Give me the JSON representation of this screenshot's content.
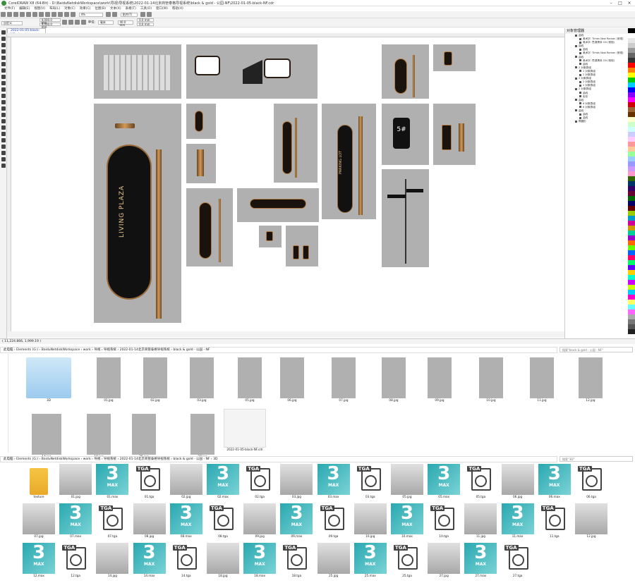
{
  "window": {
    "title": "CorelDRAW X8 (64-Bit) - D:\\BaiduNetdiskWorkspace\\work\\导视\\导视系统\\2022-01-14北京商管泰格导视系统\\black & gold - 公园-NF\\2022-01-05-black-NF.cdr"
  },
  "menubar": {
    "items": [
      "文件(F)",
      "编辑(E)",
      "视图(V)",
      "布局(L)",
      "对象(C)",
      "效果(C)",
      "位图(B)",
      "文本(X)",
      "表格(T)",
      "工具(O)",
      "窗口(W)",
      "帮助(H)"
    ]
  },
  "toolbar": {
    "preset": "自定义",
    "width": "4,000.0 mm",
    "height": "4,000.0 mm",
    "unit_label": "单位:",
    "unit": "毫米",
    "nudge": "40.0 mm",
    "dup_x": "0.0 mm",
    "dup_y": "0.0 mm",
    "zoom": "4%",
    "snap": "贴齐(T)"
  },
  "document": {
    "tab": "2022-01-05-black-NF.cdr"
  },
  "canvas": {
    "sign_text": "LIVING PLAZA",
    "parking_text": "PARKING LOT",
    "number_text": "5#"
  },
  "objects_panel": {
    "title": "对象管理器",
    "rows": [
      "曲线",
      "美术字: Times New Roman (常规)",
      "美术字: 思源黑体 CN (常规)",
      "曲线",
      "曲线",
      "美术字: Times New Roman (常规)",
      "曲线",
      "美术字: 思源黑体 CN (常规)",
      "曲线",
      "2 对象群组",
      "2 对象群组",
      "2 对象群组",
      "2 对象群组",
      "2 对象群组",
      "2 对象群组",
      "2 对象群组",
      "曲线",
      "矩形",
      "曲线",
      "6 对象群组",
      "6 对象群组",
      "曲线",
      "曲线",
      "曲线",
      "椭圆形"
    ]
  },
  "statusbar": {
    "text": "( 11,224.866, 1,999.19 )"
  },
  "explorer1": {
    "path": [
      "此电脑",
      "Elements (G:)",
      "BaiduNetdiskWorkspace",
      "work",
      "导视",
      "导视系统",
      "2022-01-14北京商管泰格导视系统",
      "black & gold - 公园 - NF"
    ],
    "search": "搜索\"black & gold - 公园 - NF\"",
    "files": [
      "3D",
      "01.jpg",
      "02.jpg",
      "03.jpg",
      "05.jpg",
      "06.jpg",
      "07.jpg",
      "08.jpg",
      "09.jpg",
      "10.jpg",
      "11.jpg",
      "12.jpg",
      "14.jpg",
      "18.jpg",
      "25.jpg",
      "27.jpg",
      "2022-01-05-black-NF.cdr"
    ]
  },
  "explorer2": {
    "path": [
      "此电脑",
      "Elements (G:)",
      "BaiduNetdiskWorkspace",
      "work",
      "导视",
      "导视系统",
      "2022-01-14北京商管泰格导视系统",
      "black & gold - 公园 - NF",
      "3D"
    ],
    "search": "搜索\"3D\"",
    "files": [
      {
        "name": "texture",
        "kind": "folder"
      },
      {
        "name": "01.jpg",
        "kind": "jpg"
      },
      {
        "name": "01.max",
        "kind": "max"
      },
      {
        "name": "01.tga",
        "kind": "tga"
      },
      {
        "name": "02.jpg",
        "kind": "jpg"
      },
      {
        "name": "02.max",
        "kind": "max"
      },
      {
        "name": "02.tga",
        "kind": "tga"
      },
      {
        "name": "03.jpg",
        "kind": "jpg"
      },
      {
        "name": "03.max",
        "kind": "max"
      },
      {
        "name": "03.tga",
        "kind": "tga"
      },
      {
        "name": "05.jpg",
        "kind": "jpg"
      },
      {
        "name": "05.max",
        "kind": "max"
      },
      {
        "name": "05.tga",
        "kind": "tga"
      },
      {
        "name": "06.jpg",
        "kind": "jpg"
      },
      {
        "name": "06.max",
        "kind": "max"
      },
      {
        "name": "06.tga",
        "kind": "tga"
      },
      {
        "name": "07.jpg",
        "kind": "jpg"
      },
      {
        "name": "07.max",
        "kind": "max"
      },
      {
        "name": "07.tga",
        "kind": "tga"
      },
      {
        "name": "08.jpg",
        "kind": "jpg"
      },
      {
        "name": "08.max",
        "kind": "max"
      },
      {
        "name": "08.tga",
        "kind": "tga"
      },
      {
        "name": "09.jpg",
        "kind": "jpg"
      },
      {
        "name": "09.max",
        "kind": "max"
      },
      {
        "name": "09.tga",
        "kind": "tga"
      },
      {
        "name": "10.jpg",
        "kind": "jpg"
      },
      {
        "name": "10.max",
        "kind": "max"
      },
      {
        "name": "10.tga",
        "kind": "tga"
      },
      {
        "name": "11.jpg",
        "kind": "jpg"
      },
      {
        "name": "11.max",
        "kind": "max"
      },
      {
        "name": "11.tga",
        "kind": "tga"
      },
      {
        "name": "12.jpg",
        "kind": "jpg"
      },
      {
        "name": "12.max",
        "kind": "max"
      },
      {
        "name": "12.tga",
        "kind": "tga"
      },
      {
        "name": "14.jpg",
        "kind": "jpg"
      },
      {
        "name": "14.max",
        "kind": "max"
      },
      {
        "name": "14.tga",
        "kind": "tga"
      },
      {
        "name": "18.jpg",
        "kind": "jpg"
      },
      {
        "name": "18.max",
        "kind": "max"
      },
      {
        "name": "18.tga",
        "kind": "tga"
      },
      {
        "name": "25.jpg",
        "kind": "jpg"
      },
      {
        "name": "25.max",
        "kind": "max"
      },
      {
        "name": "25.tga",
        "kind": "tga"
      },
      {
        "name": "27.jpg",
        "kind": "jpg"
      },
      {
        "name": "27.max",
        "kind": "max"
      },
      {
        "name": "27.tga",
        "kind": "tga"
      }
    ]
  },
  "icons": {
    "max_big": "3",
    "max_small": "MAX",
    "tga": "TGA"
  }
}
